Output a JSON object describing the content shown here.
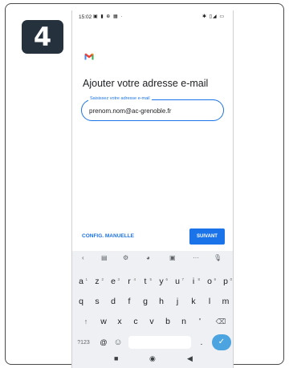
{
  "step_badge": "4",
  "status_bar": {
    "time": "15:02",
    "left_icons": "▣ ▮ ⊕ ▦ ·",
    "right_icons": "✱ ▯◢ ▭"
  },
  "app": {
    "logo_letter": "M"
  },
  "page_title": "Ajouter votre adresse e-mail",
  "email_field": {
    "label": "Saisissez votre adresse e-mail",
    "value": "prenom.nom@ac-grenoble.fr"
  },
  "actions": {
    "manual_config": "CONFIG. MANUELLE",
    "next": "SUIVANT"
  },
  "keyboard": {
    "toolbar_icons": [
      "‹",
      "▤",
      "⚙",
      "◕",
      "▣",
      "···",
      "🎙"
    ],
    "row1": [
      {
        "key": "a",
        "hint": "1"
      },
      {
        "key": "z",
        "hint": "2"
      },
      {
        "key": "e",
        "hint": "3"
      },
      {
        "key": "r",
        "hint": "4"
      },
      {
        "key": "t",
        "hint": "5"
      },
      {
        "key": "y",
        "hint": "6"
      },
      {
        "key": "u",
        "hint": "7"
      },
      {
        "key": "i",
        "hint": "8"
      },
      {
        "key": "o",
        "hint": "9"
      },
      {
        "key": "p",
        "hint": "0"
      }
    ],
    "row2": [
      "q",
      "s",
      "d",
      "f",
      "g",
      "h",
      "j",
      "k",
      "l",
      "m"
    ],
    "row3": [
      "↑",
      "w",
      "x",
      "c",
      "v",
      "b",
      "n",
      "'",
      "⌫"
    ],
    "row4": {
      "numbers": "?123",
      "at": "@",
      "emoji": "☺",
      "period": ".",
      "enter": "✓"
    }
  },
  "nav_bar": {
    "recents": "■",
    "home": "◉",
    "back": "◀"
  },
  "colors": {
    "accent": "#1a73e8",
    "badge_bg": "#25313d",
    "keyboard_bg": "#eef0f3"
  }
}
